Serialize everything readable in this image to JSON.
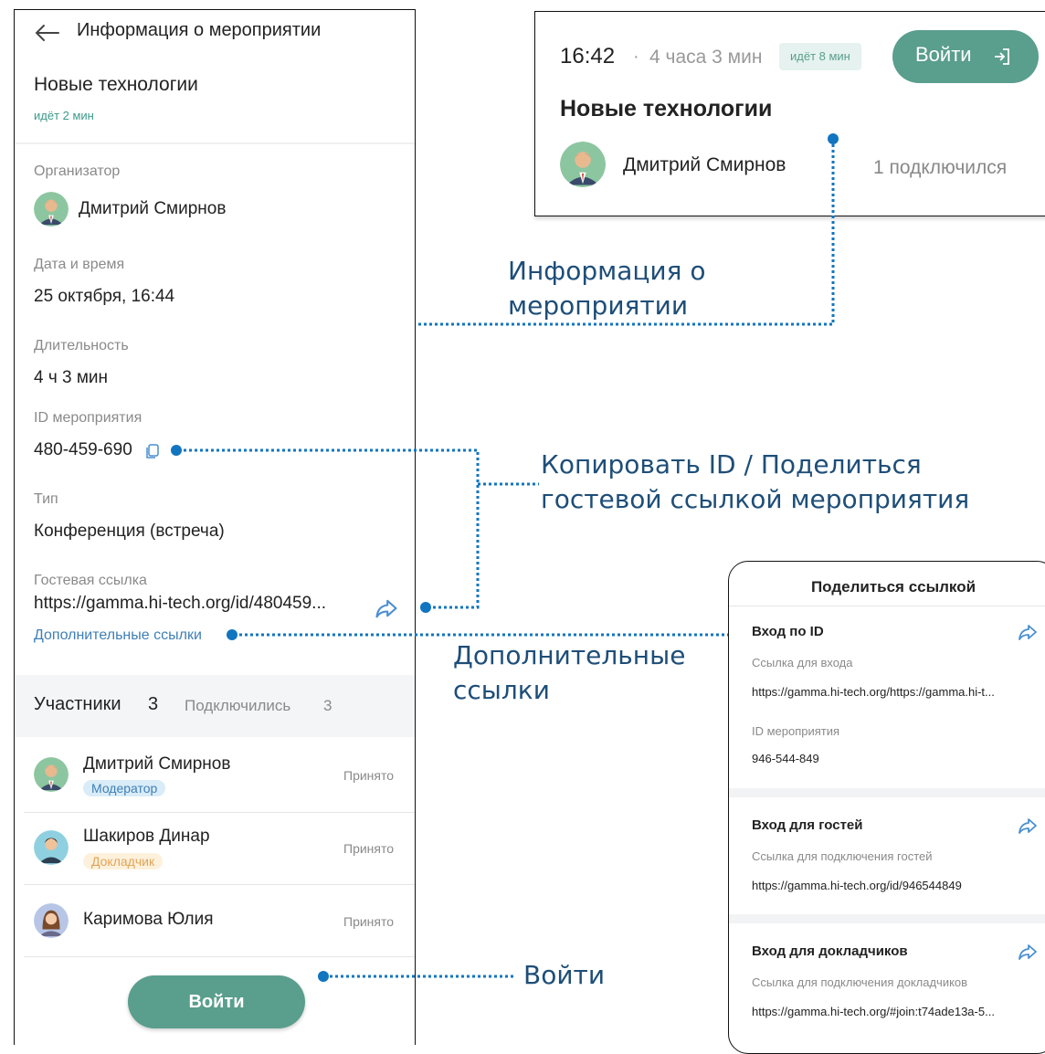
{
  "left_panel": {
    "header_title": "Информация о мероприятии",
    "event_title": "Новые технологии",
    "event_status": "идёт 2 мин",
    "organizer_label": "Организатор",
    "organizer_name": "Дмитрий Смирнов",
    "datetime_label": "Дата и время",
    "datetime_value": "25 октября, 16:44",
    "duration_label": "Длительность",
    "duration_value": "4 ч 3 мин",
    "event_id_label": "ID мероприятия",
    "event_id_value": "480-459-690",
    "type_label": "Тип",
    "type_value": "Конференция (встреча)",
    "guest_link_label": "Гостевая ссылка",
    "guest_link_value": "https://gamma.hi-tech.org/id/480459...",
    "more_links": "Дополнительные ссылки",
    "participants_label": "Участники",
    "participants_count": "3",
    "connected_label": "Подключились",
    "connected_count": "3",
    "participants": [
      {
        "name": "Дмитрий Смирнов",
        "role": "Модератор",
        "status": "Принято"
      },
      {
        "name": "Шакиров Динар",
        "role": "Докладчик",
        "status": "Принято"
      },
      {
        "name": "Каримова Юлия",
        "role": "",
        "status": "Принято"
      }
    ],
    "join_button": "Войти"
  },
  "top_card": {
    "time": "16:42",
    "separator": "·",
    "duration": "4 часа 3 мин",
    "status_badge": "идёт 8 мин",
    "join_button": "Войти",
    "title": "Новые технологии",
    "organizer_name": "Дмитрий Смирнов",
    "connected": "1 подключился"
  },
  "share_panel": {
    "title": "Поделиться ссылкой",
    "sections": [
      {
        "heading": "Вход по ID",
        "link_label": "Ссылка для входа",
        "link_value": "https://gamma.hi-tech.org/https://gamma.hi-t...",
        "id_label": "ID мероприятия",
        "id_value": "946-544-849"
      },
      {
        "heading": "Вход для гостей",
        "link_label": "Ссылка для подключения гостей",
        "link_value": "https://gamma.hi-tech.org/id/946544849"
      },
      {
        "heading": "Вход для докладчиков",
        "link_label": "Ссылка для подключения докладчиков",
        "link_value": "https://gamma.hi-tech.org/#join:t74ade13a-5..."
      }
    ]
  },
  "annotations": {
    "event_info_line1": "Информация о",
    "event_info_line2": "мероприятии",
    "copy_share_line1": "Копировать ID / Поделиться",
    "copy_share_line2": "гостевой ссылкой мероприятия",
    "more_links_line1": "Дополнительные",
    "more_links_line2": "ссылки",
    "join": "Войти"
  },
  "colors": {
    "accent_green": "#5a9e8d",
    "link_blue": "#3f7fb5",
    "annotation_blue": "#1e4e78",
    "dot_blue": "#1275c0",
    "moderator_badge_bg": "#d9ecf8",
    "speaker_badge_bg": "#fdf1dc"
  },
  "icons": [
    "back-arrow-icon",
    "copy-icon",
    "share-icon",
    "login-icon",
    "avatar-icon"
  ]
}
